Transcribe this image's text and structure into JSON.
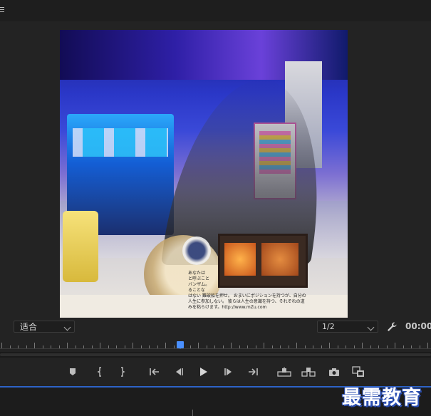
{
  "monitor": {
    "fit_label": "适合",
    "resolution_label": "1/2",
    "timecode": "00:00"
  },
  "video": {
    "caption_lines": [
      "あなたは",
      "と呼ぶこと",
      "バンザム。",
      "ることな",
      "はない 難破船を押せ。 おまいにポジションを持つが、自分の",
      "人生に参加しない。 彼らは人生の意識を持つ、それぞれの道",
      "みを粘らけます。http://www.mZu.com"
    ]
  },
  "transport": {
    "buttons": [
      "add-marker",
      "mark-in",
      "mark-out",
      "go-to-in",
      "step-back",
      "play",
      "step-forward",
      "go-to-out",
      "lift",
      "extract",
      "export-frame",
      "comparison-view"
    ]
  },
  "watermark": {
    "text": "最需教育"
  }
}
